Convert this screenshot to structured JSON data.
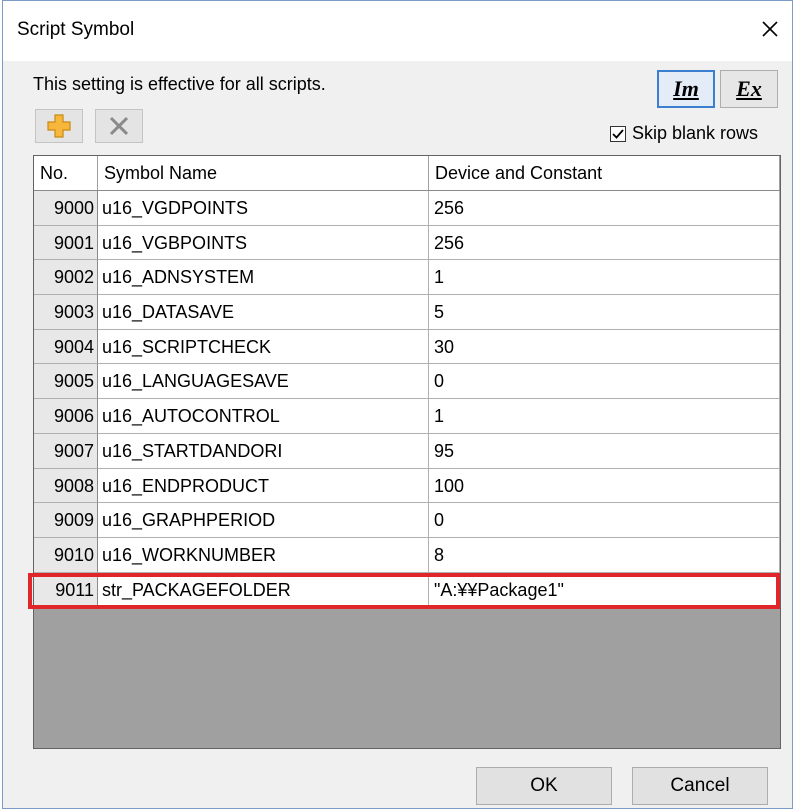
{
  "window": {
    "title": "Script Symbol"
  },
  "info_text": "This setting is effective for all scripts.",
  "toolbar": {
    "add_icon": "plus-icon",
    "delete_icon": "x-icon",
    "import_label": "Im",
    "export_label": "Ex"
  },
  "skip_blank_rows": {
    "label": "Skip blank rows",
    "checked": true
  },
  "table": {
    "headers": {
      "no": "No.",
      "name": "Symbol Name",
      "device": "Device and Constant"
    },
    "rows": [
      {
        "no": "9000",
        "name": "u16_VGDPOINTS",
        "device": "256"
      },
      {
        "no": "9001",
        "name": "u16_VGBPOINTS",
        "device": "256"
      },
      {
        "no": "9002",
        "name": "u16_ADNSYSTEM",
        "device": "1"
      },
      {
        "no": "9003",
        "name": "u16_DATASAVE",
        "device": "5"
      },
      {
        "no": "9004",
        "name": "u16_SCRIPTCHECK",
        "device": "30"
      },
      {
        "no": "9005",
        "name": "u16_LANGUAGESAVE",
        "device": "0"
      },
      {
        "no": "9006",
        "name": "u16_AUTOCONTROL",
        "device": "1"
      },
      {
        "no": "9007",
        "name": "u16_STARTDANDORI",
        "device": "95"
      },
      {
        "no": "9008",
        "name": "u16_ENDPRODUCT",
        "device": "100"
      },
      {
        "no": "9009",
        "name": "u16_GRAPHPERIOD",
        "device": "0"
      },
      {
        "no": "9010",
        "name": "u16_WORKNUMBER",
        "device": "8"
      },
      {
        "no": "9011",
        "name": "str_PACKAGEFOLDER",
        "device": "\"A:¥¥Package1\""
      }
    ]
  },
  "buttons": {
    "ok": "OK",
    "cancel": "Cancel"
  },
  "colors": {
    "highlight": "#e0252b",
    "grid_empty": "#a0a0a0"
  }
}
